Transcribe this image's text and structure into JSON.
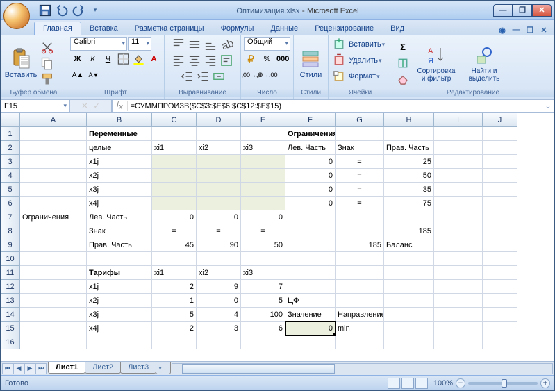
{
  "title": {
    "app": "Microsoft Excel",
    "file": "Оптимизация.xlsx"
  },
  "tabs": [
    "Главная",
    "Вставка",
    "Разметка страницы",
    "Формулы",
    "Данные",
    "Рецензирование",
    "Вид"
  ],
  "active_tab": 0,
  "ribbon": {
    "clipboard": {
      "label": "Буфер обмена",
      "paste": "Вставить"
    },
    "font": {
      "label": "Шрифт",
      "name": "Calibri",
      "size": "11"
    },
    "align": {
      "label": "Выравнивание"
    },
    "number": {
      "label": "Число",
      "format": "Общий"
    },
    "styles": {
      "label": "Стили",
      "btn": "Стили"
    },
    "cells": {
      "label": "Ячейки",
      "insert": "Вставить",
      "delete": "Удалить",
      "format": "Формат"
    },
    "editing": {
      "label": "Редактирование",
      "sort": "Сортировка и фильтр",
      "find": "Найти и выделить"
    }
  },
  "namebox": "F15",
  "formula": "=СУММПРОИЗВ($C$3:$E$6;$C$12:$E$15)",
  "columns": [
    "",
    "A",
    "B",
    "C",
    "D",
    "E",
    "F",
    "G",
    "H",
    "I",
    "J"
  ],
  "rows": [
    "1",
    "2",
    "3",
    "4",
    "5",
    "6",
    "7",
    "8",
    "9",
    "10",
    "11",
    "12",
    "13",
    "14",
    "15",
    "16"
  ],
  "cells": {
    "B1": "Переменные",
    "F1": "Ограничения",
    "B2": "целые",
    "C2": "xi1",
    "D2": "xi2",
    "E2": "xi3",
    "F2": "Лев. Часть",
    "G2": "Знак",
    "H2": "Прав. Часть",
    "B3": "x1j",
    "F3": "0",
    "G3": "=",
    "H3": "25",
    "B4": "x2j",
    "F4": "0",
    "G4": "=",
    "H4": "50",
    "B5": "x3j",
    "F5": "0",
    "G5": "=",
    "H5": "35",
    "B6": "x4j",
    "F6": "0",
    "G6": "=",
    "H6": "75",
    "A7": "Ограничения",
    "B7": "Лев. Часть",
    "C7": "0",
    "D7": "0",
    "E7": "0",
    "B8": "Знак",
    "C8": "=",
    "D8": "=",
    "E8": "=",
    "H8": "185",
    "B9": "Прав. Часть",
    "C9": "45",
    "D9": "90",
    "E9": "50",
    "G9": "185",
    "H9": "Баланс",
    "B11": "Тарифы",
    "C11": "xi1",
    "D11": "xi2",
    "E11": "xi3",
    "B12": "x1j",
    "C12": "2",
    "D12": "9",
    "E12": "7",
    "B13": "x2j",
    "C13": "1",
    "D13": "0",
    "E13": "5",
    "F13": "ЦФ",
    "B14": "x3j",
    "C14": "5",
    "D14": "4",
    "E14": "100",
    "F14": "Значение",
    "G14": "Направление",
    "B15": "x4j",
    "C15": "2",
    "D15": "3",
    "E15": "6",
    "F15": "0",
    "G15": "min"
  },
  "sheets": [
    "Лист1",
    "Лист2",
    "Лист3"
  ],
  "active_sheet": 0,
  "status": "Готово",
  "zoom": "100%"
}
